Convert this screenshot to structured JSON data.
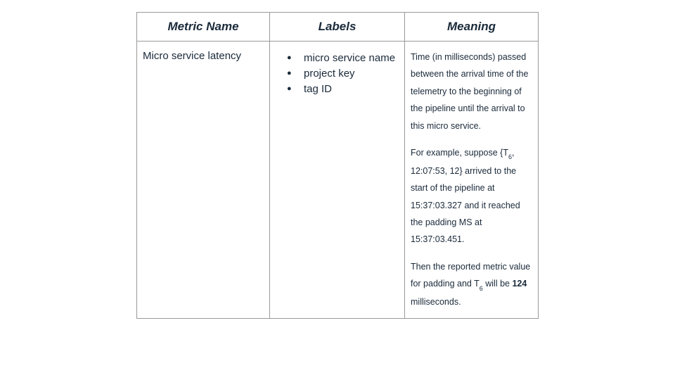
{
  "headers": {
    "metric": "Metric Name",
    "labels": "Labels",
    "meaning": "Meaning"
  },
  "row": {
    "metric_name": "Micro service latency",
    "labels": [
      "micro service name",
      "project key",
      "tag ID"
    ],
    "meaning": {
      "p1": "Time (in milliseconds) passed between the arrival time of the telemetry to the beginning of the pipeline until the arrival to this micro service.",
      "p2_pre": "For example, suppose {T",
      "p2_sub": "6",
      "p2_post": ", 12:07:53, 12} arrived to the start of the pipeline at 15:37:03.327 and it reached the padding MS at 15:37:03.451.",
      "p3_pre": "Then the reported metric value for padding and T",
      "p3_sub": "6",
      "p3_mid": " will be ",
      "p3_bold": "124",
      "p3_post": " milliseconds."
    }
  }
}
